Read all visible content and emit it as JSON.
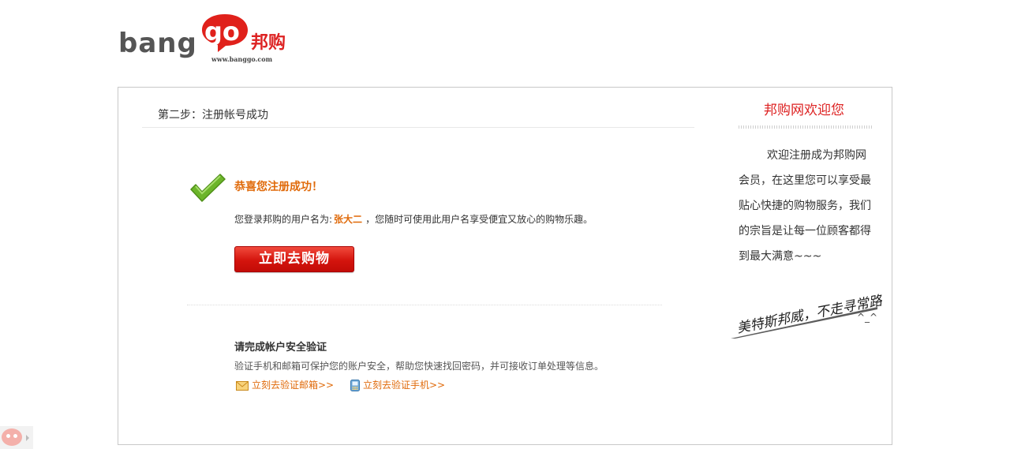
{
  "logo": {
    "bang": "bang",
    "go": "go",
    "cn": "邦购",
    "url": "www.banggo.com"
  },
  "step": {
    "title": "第二步：注册帐号成功"
  },
  "success": {
    "title": "恭喜您注册成功！",
    "login_prefix": "您登录邦购的用户名为:",
    "username": "张大二",
    "login_suffix": "，您随时可使用此用户名享受便宜又放心的购物乐趣。",
    "shop_button": "立即去购物"
  },
  "verify": {
    "title": "请完成帐户安全验证",
    "desc": "验证手机和邮箱可保护您的账户安全，帮助您快速找回密码，并可接收订单处理等信息。",
    "email_link": "立刻去验证邮箱>>",
    "phone_link": "立刻去验证手机>>"
  },
  "side": {
    "title": "邦购网欢迎您",
    "text": "欢迎注册成为邦购网会员，在这里您可以享受最贴心快捷的购物服务，我们的宗旨是让每一位顾客都得到最大满意~~~",
    "signature": "美特斯邦威，不走寻常路！",
    "smile": "^_^"
  },
  "colors": {
    "accent_orange": "#e06a0a",
    "brand_red": "#dd2222",
    "check_green": "#6cb52a"
  },
  "icons": {
    "check": "check-icon",
    "email": "envelope-icon",
    "phone": "phone-icon"
  }
}
